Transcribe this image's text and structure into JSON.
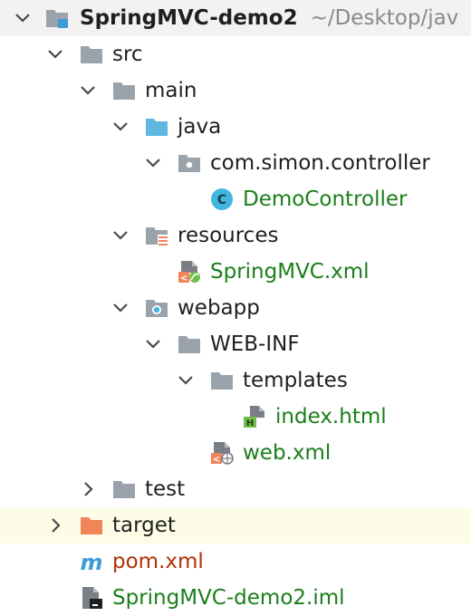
{
  "tree": {
    "root": {
      "label": "SpringMVC-demo2",
      "path": "~/Desktop/jav",
      "icon": "module-folder-icon",
      "expanded": true
    },
    "src": {
      "label": "src",
      "icon": "folder-icon",
      "expanded": true
    },
    "main": {
      "label": "main",
      "icon": "folder-icon",
      "expanded": true
    },
    "java": {
      "label": "java",
      "icon": "source-root-folder-icon",
      "expanded": true
    },
    "package": {
      "label": "com.simon.controller",
      "icon": "package-icon",
      "expanded": true
    },
    "demo_controller": {
      "label": "DemoController",
      "icon": "java-class-icon",
      "badge": "C"
    },
    "resources": {
      "label": "resources",
      "icon": "resources-folder-icon",
      "expanded": true
    },
    "springmvc_xml": {
      "label": "SpringMVC.xml",
      "icon": "spring-xml-icon"
    },
    "webapp": {
      "label": "webapp",
      "icon": "web-folder-icon",
      "expanded": true
    },
    "web_inf": {
      "label": "WEB-INF",
      "icon": "folder-icon",
      "expanded": true
    },
    "templates": {
      "label": "templates",
      "icon": "folder-icon",
      "expanded": true
    },
    "index_html": {
      "label": "index.html",
      "icon": "html-file-icon",
      "badge": "H"
    },
    "web_xml": {
      "label": "web.xml",
      "icon": "web-xml-icon"
    },
    "test": {
      "label": "test",
      "icon": "folder-icon",
      "expanded": false
    },
    "target": {
      "label": "target",
      "icon": "excluded-folder-icon",
      "expanded": false
    },
    "pom_xml": {
      "label": "pom.xml",
      "icon": "maven-icon",
      "badge": "m"
    },
    "iml": {
      "label": "SpringMVC-demo2.iml",
      "icon": "iml-file-icon"
    }
  },
  "colors": {
    "folder": "#9aa3ab",
    "source_blue": "#5fb8e0",
    "class_badge": "#40b6e0",
    "green_text": "#1a7f1a",
    "red_text": "#b2310a",
    "orange": "#f0855a",
    "maven_blue": "#3d9bd7",
    "highlight": "#fdfce6"
  }
}
